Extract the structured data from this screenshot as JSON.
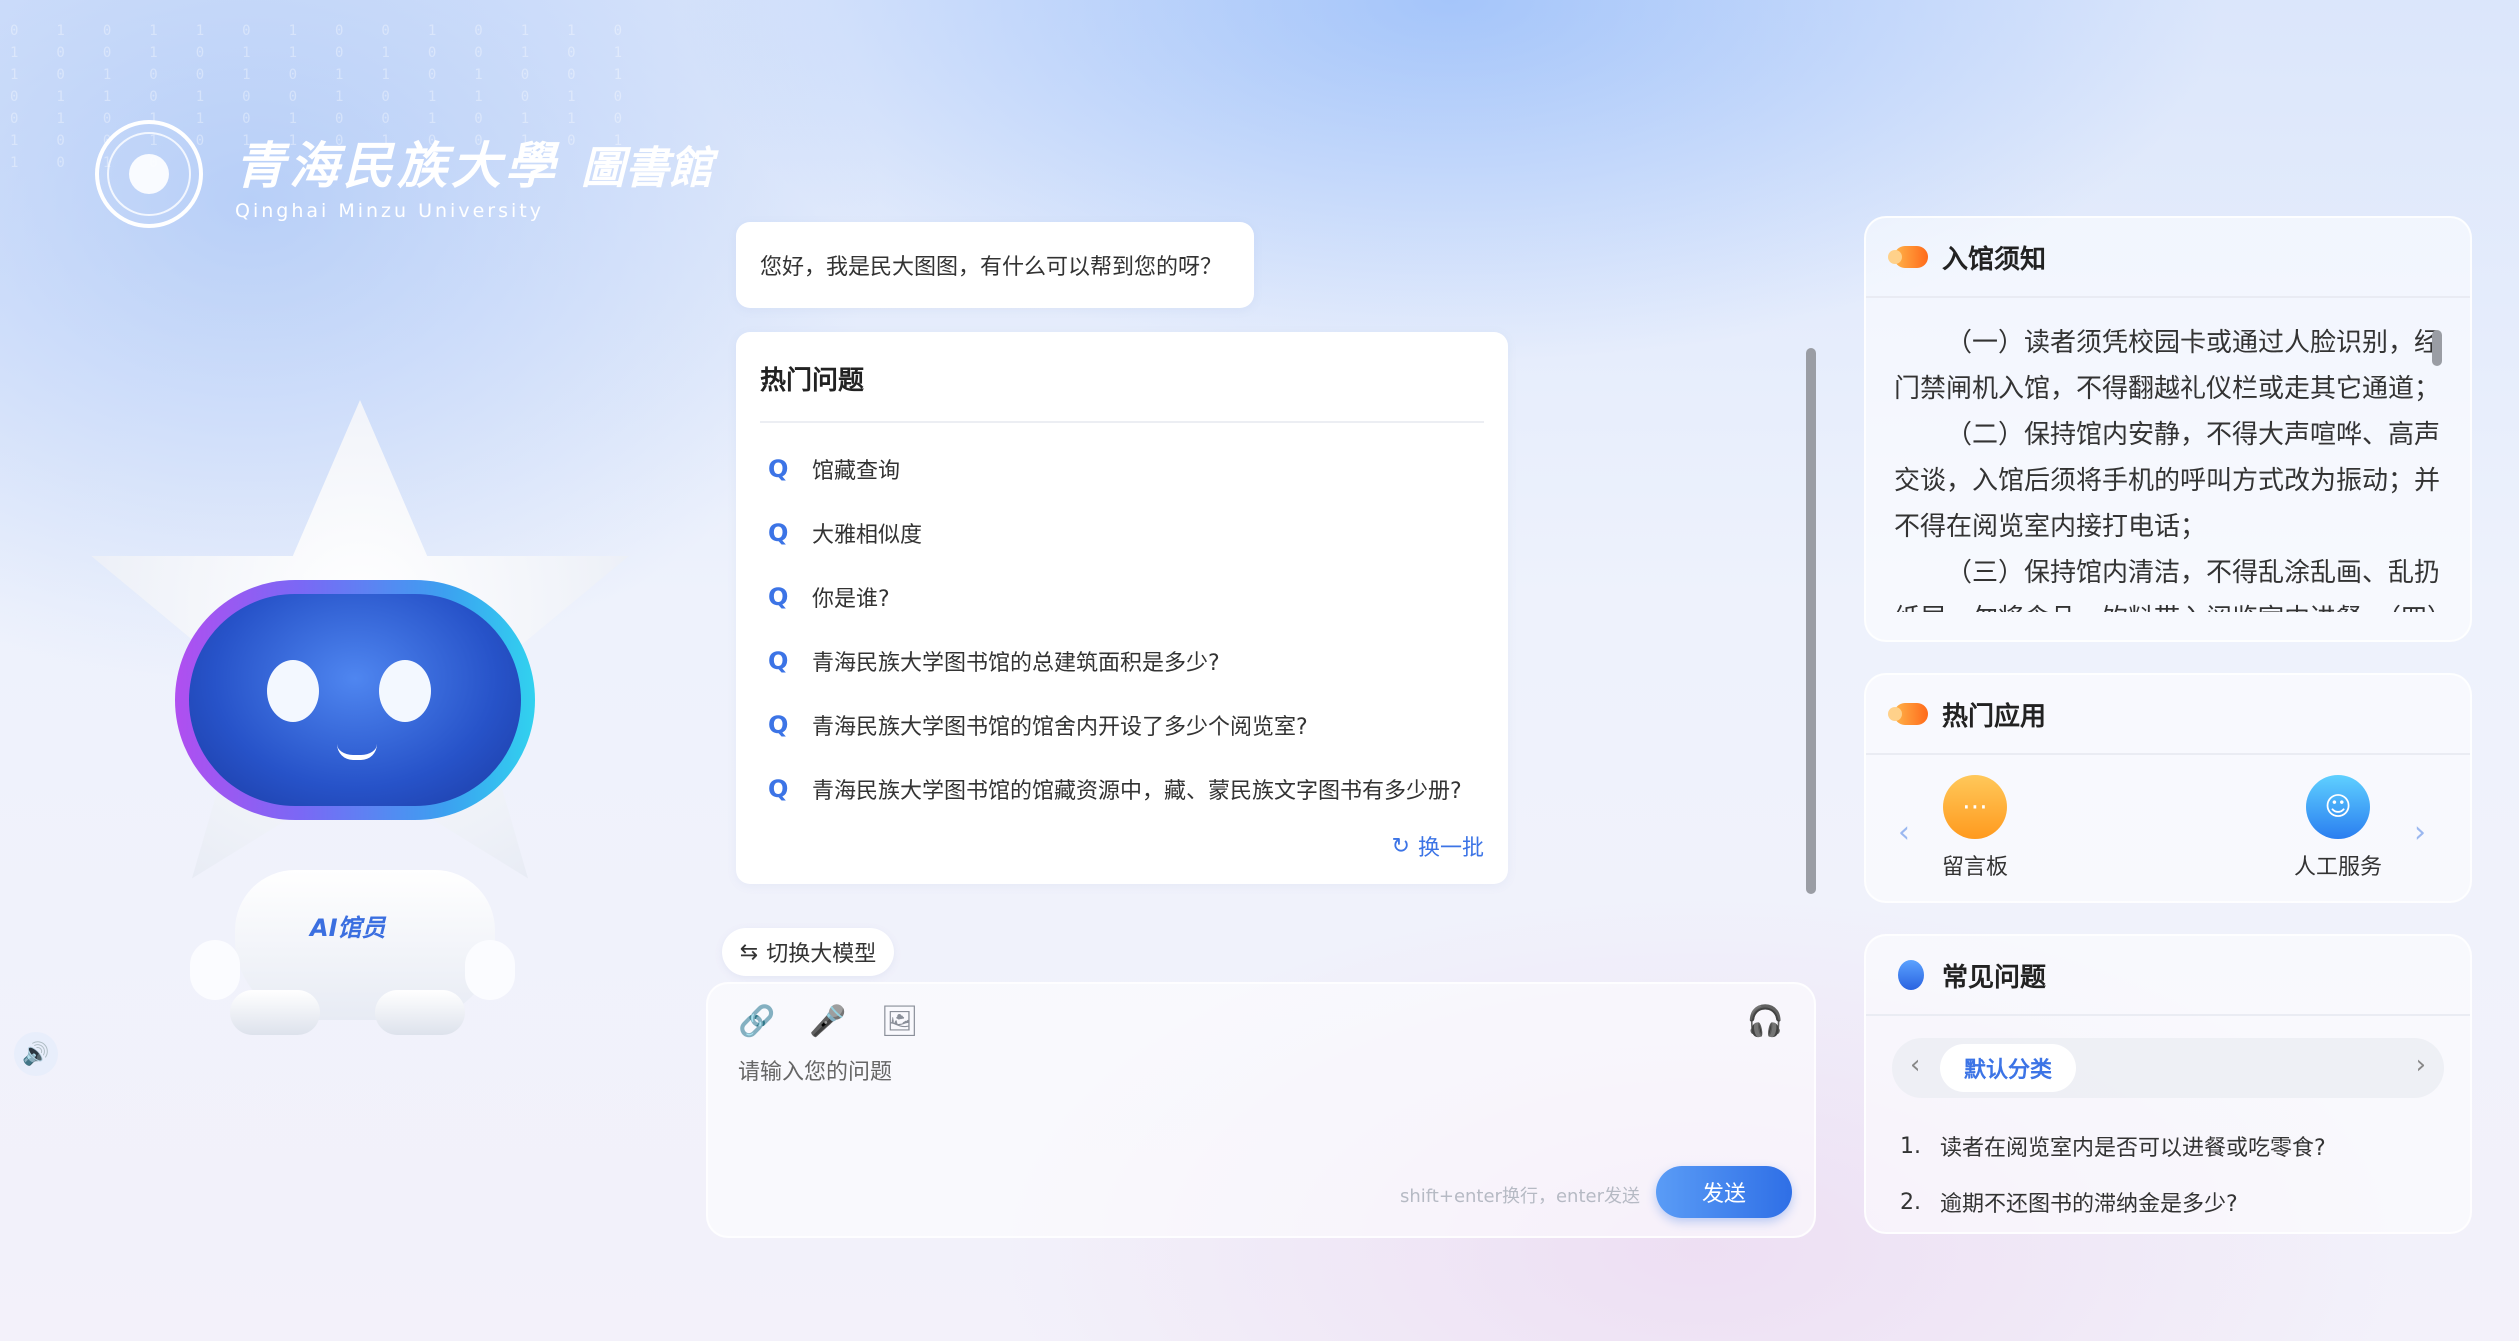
{
  "logo": {
    "school_cn": "青海民族大學",
    "library_cn": "圖書館",
    "school_en": "Qinghai Minzu University"
  },
  "robot": {
    "badge": "AI馆员"
  },
  "chat": {
    "greeting": "您好，我是民大图图，有什么可以帮到您的呀？",
    "hot_title": "热门问题",
    "question_mark": "Q",
    "hot_questions": [
      "馆藏查询",
      "大雅相似度",
      "你是谁?",
      "青海民族大学图书馆的总建筑面积是多少?",
      "青海民族大学图书馆的馆舍内开设了多少个阅览室?",
      "青海民族大学图书馆的馆藏资源中，藏、蒙民族文字图书有多少册?"
    ],
    "refresh_label": "换一批",
    "switch_model_label": "切换大模型",
    "input_placeholder": "请输入您的问题",
    "input_hint": "shift+enter换行，enter发送",
    "send_label": "发送"
  },
  "notice": {
    "title": "入馆须知",
    "paragraphs": [
      "（一）读者须凭校园卡或通过人脸识别，经门禁闸机入馆，不得翻越礼仪栏或走其它通道；",
      "（二）保持馆内安静，不得大声喧哗、高声交谈，入馆后须将手机的呼叫方式改为振动；并不得在阅览室内接打电话；",
      "（三）保持馆内清洁，不得乱涂乱画、乱扔纸屑，勿将食品、饮料带入阅览室内进餐。（四）"
    ]
  },
  "apps": {
    "title": "热门应用",
    "items": [
      {
        "label": "留言板",
        "icon": "message-board-icon"
      },
      {
        "label": "人工服务",
        "icon": "customer-service-icon"
      }
    ]
  },
  "faq": {
    "title": "常见问题",
    "category": "默认分类",
    "items": [
      {
        "num": "1.",
        "text": "读者在阅览室内是否可以进餐或吃零食?"
      },
      {
        "num": "2.",
        "text": "逾期不还图书的滞纳金是多少?"
      }
    ]
  },
  "colors": {
    "accent": "#3c74e6",
    "send_start": "#5a9cf6",
    "send_end": "#2f6fe6"
  }
}
